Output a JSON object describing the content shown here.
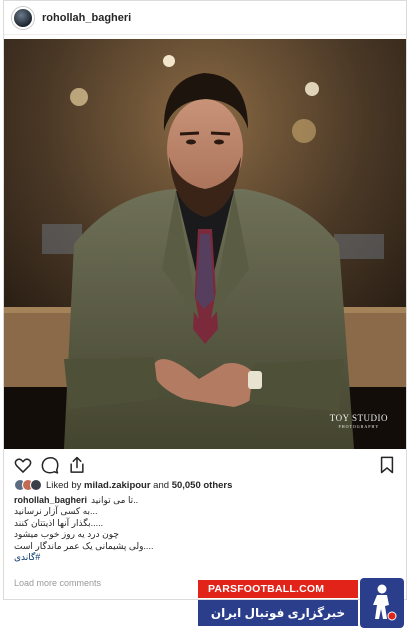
{
  "post": {
    "username": "rohollah_bagheri"
  },
  "photo": {
    "watermark_main": "TOY STUDIO",
    "watermark_sub": "PHOTOGRAPHY"
  },
  "actions": {
    "like_icon": "heart-icon",
    "comment_icon": "comment-icon",
    "share_icon": "share-icon",
    "save_icon": "bookmark-icon"
  },
  "likes": {
    "prefix": "Liked by ",
    "user": "milad.zakipour",
    "middle": " and ",
    "count": "50,050 others"
  },
  "caption": {
    "username": "rohollah_bagheri",
    "lines": [
      "..تا می توانید",
      "...به کسی آزار نرسانید",
      ".....بگذار آنها اذیتتان کنند",
      "چون درد یه روز خوب میشود",
      "....ولی پشیمانی یک عمر ماندگار است"
    ],
    "hashtag": "#گاندی"
  },
  "comments": {
    "load_more": "Load more comments"
  },
  "banner": {
    "site": "PARSFOOTBALL.COM",
    "tagline": "خبرگزاری فوتبال ایران"
  },
  "colors": {
    "banner_red": "#e2231a",
    "banner_blue": "#2a3e8c",
    "hashtag": "#003569",
    "muted": "#999999"
  }
}
